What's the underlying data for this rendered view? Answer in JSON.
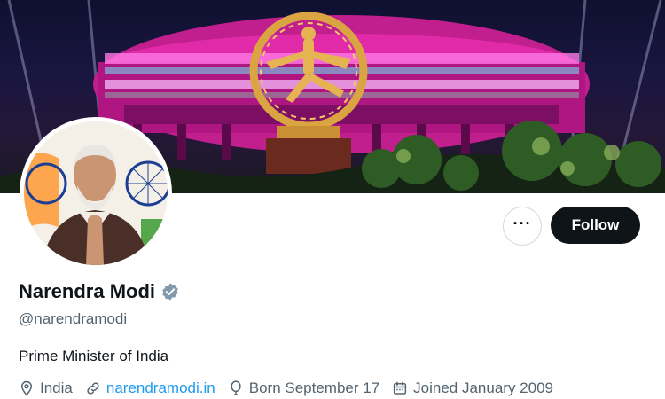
{
  "profile": {
    "name": "Narendra Modi",
    "handle": "@narendramodi",
    "bio": "Prime Minister of India",
    "location": "India",
    "website": "narendramodi.in",
    "birthday": "Born September 17",
    "joined": "Joined January 2009"
  },
  "actions": {
    "more_label": "···",
    "follow_label": "Follow"
  },
  "icons": {
    "verified": "verified-badge-icon",
    "location": "location-pin-icon",
    "website": "link-icon",
    "birthday": "balloon-icon",
    "joined": "calendar-icon"
  },
  "colors": {
    "verified": "#829aab",
    "link": "#1d9bf0",
    "secondary_text": "#536471",
    "follow_bg": "#0f1419"
  }
}
